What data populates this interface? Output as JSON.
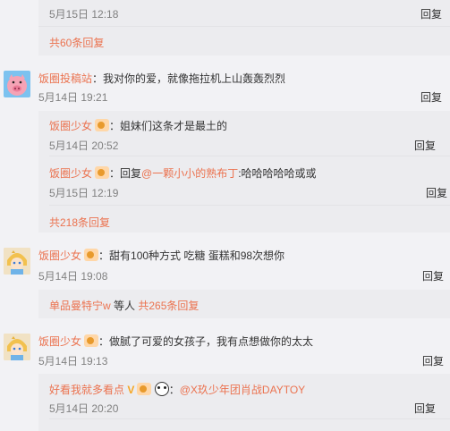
{
  "top": {
    "time": "5月15日 12:18",
    "reply": "回复",
    "more": "共60条回复"
  },
  "c1": {
    "user": "饭圈投稿站",
    "text": "：我对你的爱，就像拖拉机上山轰轰烈烈",
    "time": "5月14日 19:21",
    "reply": "回复",
    "subs": [
      {
        "user": "饭圈少女",
        "text": "：姐妹们这条才是最土的",
        "time": "5月14日 20:52",
        "reply": "回复"
      },
      {
        "user": "饭圈少女",
        "text_pre": "：回复",
        "mention": "@一颗小小的熟布丁",
        "text_post": ":哈哈哈哈哈或或",
        "time": "5月15日 12:19",
        "reply": "回复"
      }
    ],
    "more": "共218条回复"
  },
  "c2": {
    "user": "饭圈少女",
    "text": "：甜有100种方式 吃糖 蛋糕和98次想你",
    "time": "5月14日 19:08",
    "reply": "回复",
    "summary_user": "单品曼特宁w",
    "summary_mid": " 等人 ",
    "summary_more": "共265条回复"
  },
  "c3": {
    "user": "饭圈少女",
    "text": "：做腻了可爱的女孩子，我有点想做你的太太",
    "time": "5月14日 19:13",
    "reply": "回复",
    "sub": {
      "user": "好看我就多看点",
      "text_pre": "：",
      "mention": "@X玖少年团肖战DAYTOY",
      "time": "5月14日 20:20",
      "reply": "回复"
    }
  }
}
